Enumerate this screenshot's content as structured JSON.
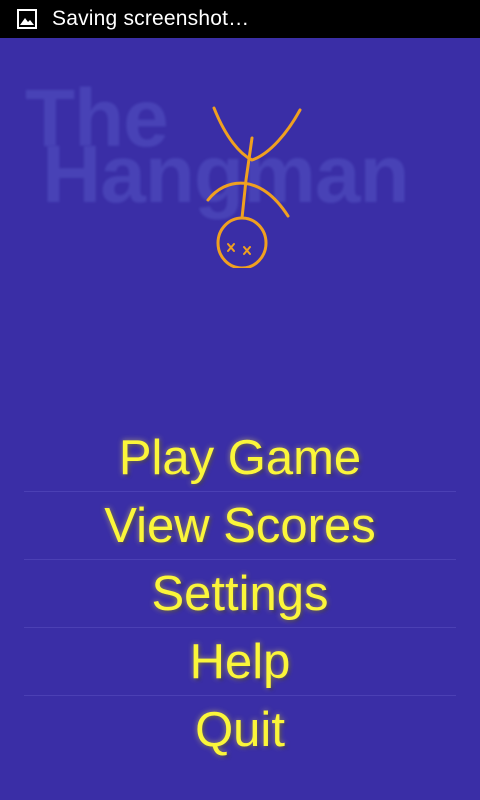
{
  "status_bar": {
    "icon": "image-icon",
    "notification_text": "Saving screenshot…"
  },
  "logo": {
    "line1": "The",
    "line2": "Hangman",
    "figure_icon": "hangman-figure-icon",
    "figure_color": "#f0a020"
  },
  "menu": {
    "items": [
      {
        "label": "Play Game"
      },
      {
        "label": "View Scores"
      },
      {
        "label": "Settings"
      },
      {
        "label": "Help"
      },
      {
        "label": "Quit"
      }
    ]
  },
  "colors": {
    "background": "#3a2ea6",
    "menu_text": "#fbf63a",
    "status_bar": "#000000"
  }
}
